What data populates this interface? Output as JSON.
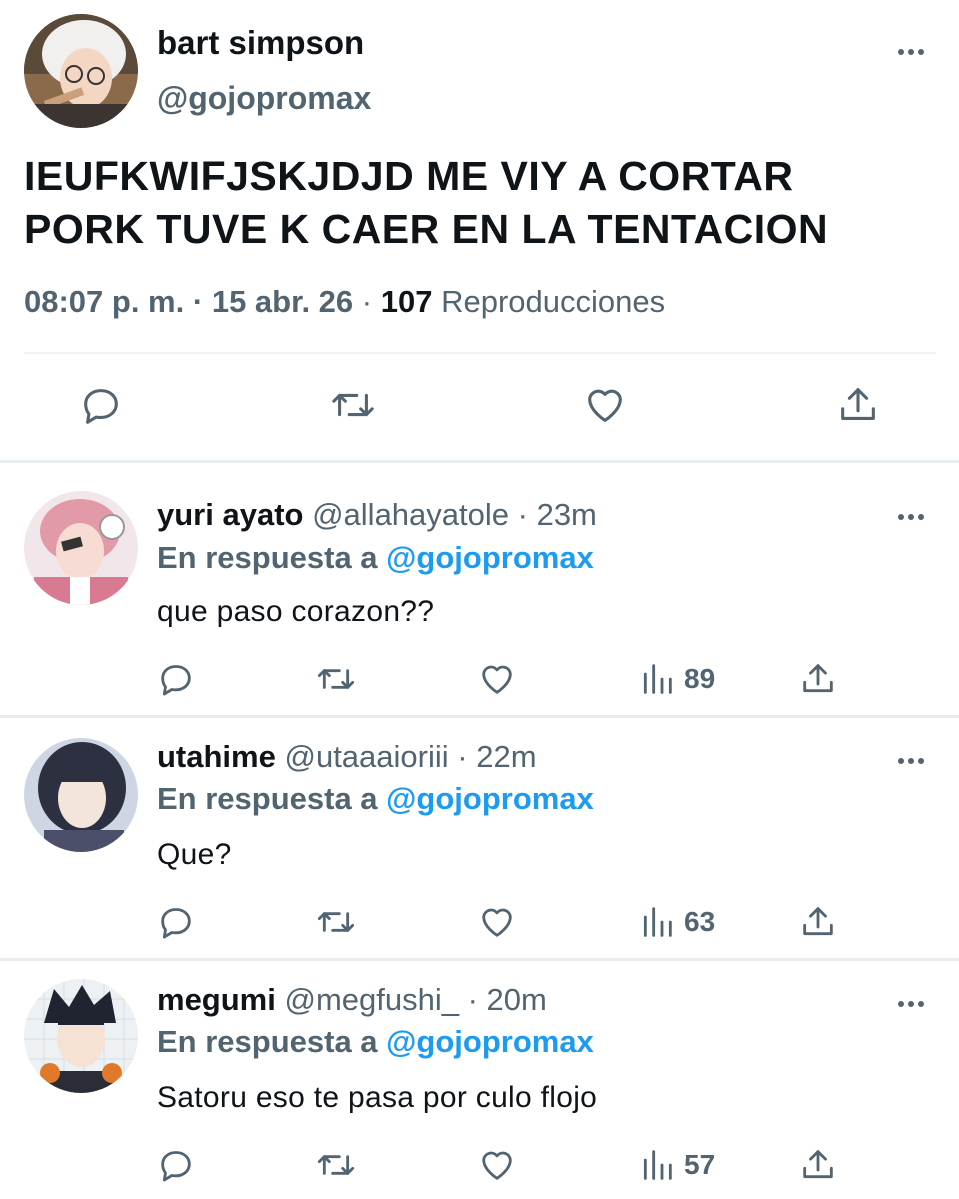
{
  "main_tweet": {
    "display_name": "bart simpson",
    "handle": "@gojopromax",
    "text_line1": "IEUFKWIFJSKJDJD ME VIY A CORTAR",
    "text_line2": "PORK TUVE K CAER EN LA TENTACION",
    "time": "08:07 p. m.",
    "dot": "·",
    "date": "15 abr. 26",
    "views_count": "107",
    "views_label": "Reproducciones",
    "icons": [
      "reply-icon",
      "retweet-icon",
      "like-icon",
      "share-icon"
    ]
  },
  "replies": [
    {
      "display_name": "yuri ayato",
      "handle": "@allahayatole",
      "time": "· 23m",
      "in_reply_prefix": "En respuesta a",
      "in_reply_handle": "@gojopromax",
      "text": "que paso corazon??",
      "views": "89"
    },
    {
      "display_name": "utahime",
      "handle": "@utaaaioriii",
      "time": "· 22m",
      "in_reply_prefix": "En respuesta a",
      "in_reply_handle": "@gojopromax",
      "text": "Que?",
      "views": "63"
    },
    {
      "display_name": "megumi",
      "handle": "@megfushi_",
      "time": "· 20m",
      "in_reply_prefix": "En respuesta a",
      "in_reply_handle": "@gojopromax",
      "text": "Satoru eso te pasa por culo flojo",
      "views": "57"
    }
  ],
  "colors": {
    "text": "#0f1419",
    "secondary": "#536471",
    "link": "#1d9bf0",
    "divider": "#eff3f4"
  }
}
